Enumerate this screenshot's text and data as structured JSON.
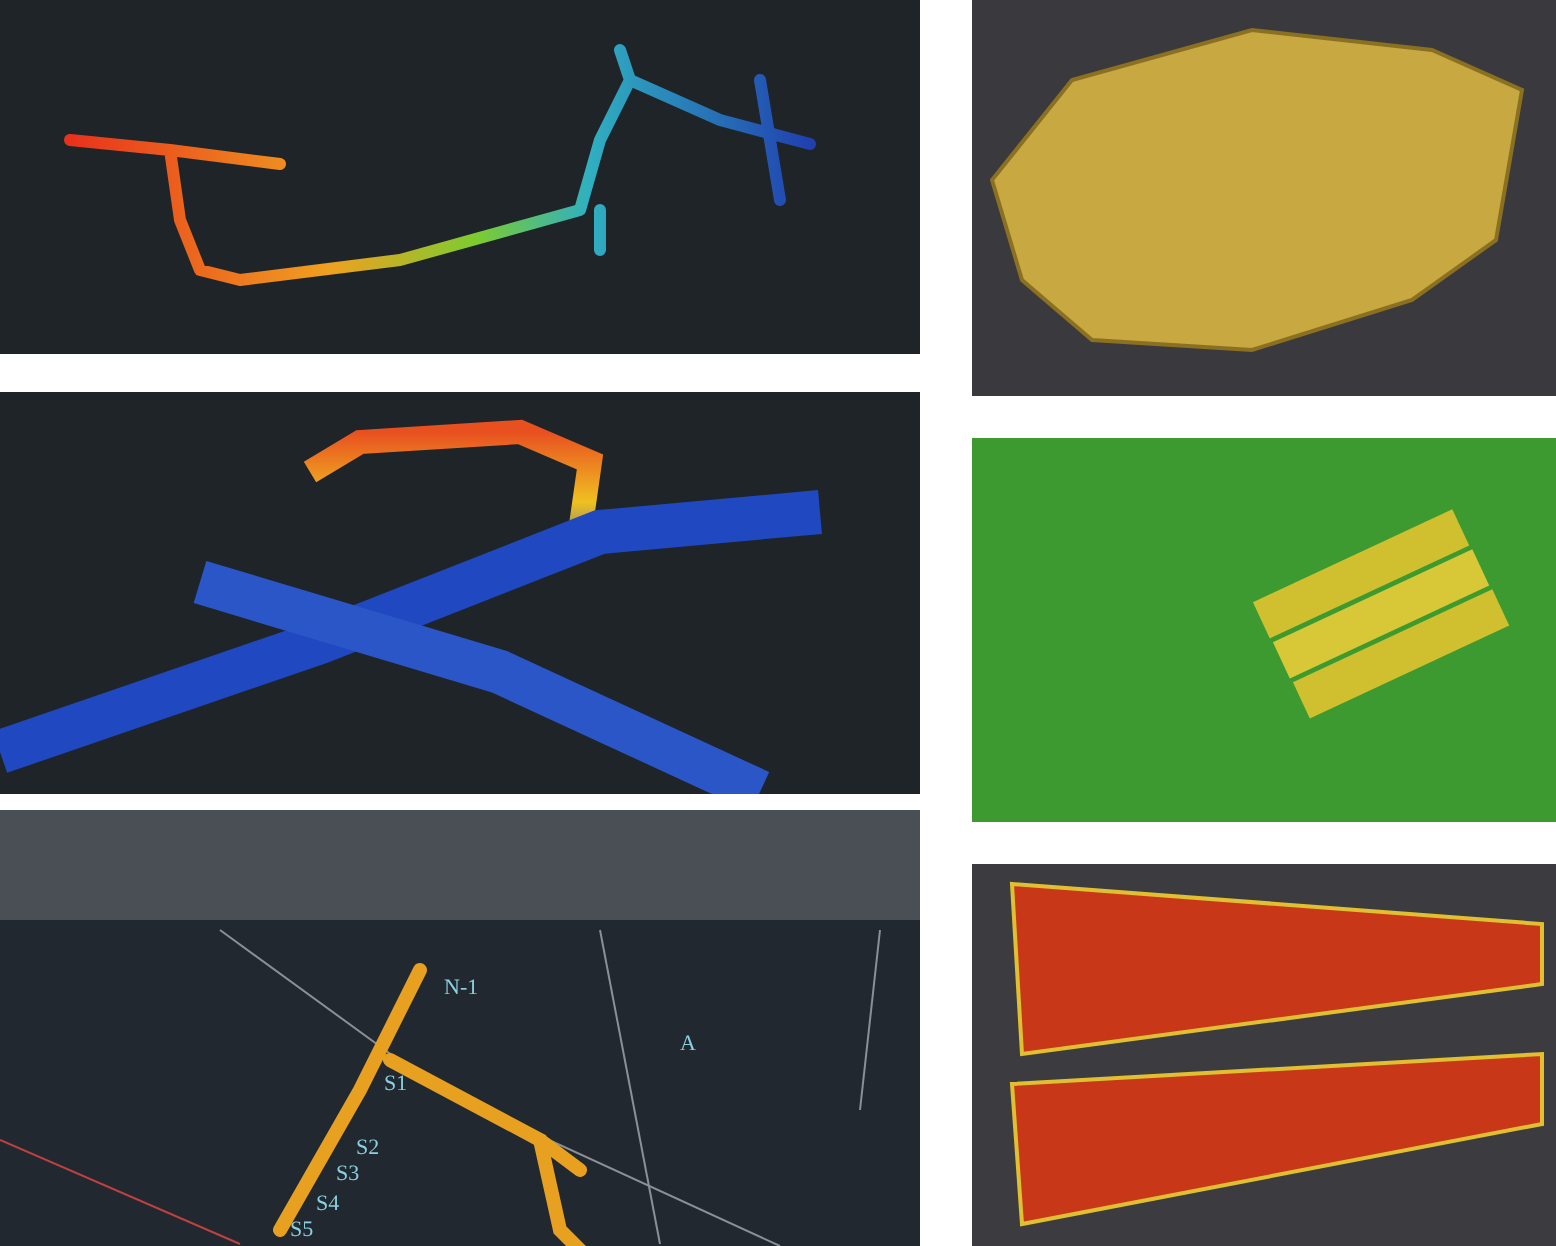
{
  "panels": [
    {
      "kind": "tunnel-gradient"
    },
    {
      "kind": "mesh"
    },
    {
      "kind": "tunnel-layers"
    },
    {
      "kind": "terrain"
    },
    {
      "kind": "cad"
    },
    {
      "kind": "corridor"
    }
  ],
  "cad_labels": [
    "N-1",
    "A",
    "S1",
    "S2",
    "S3",
    "S4",
    "S5"
  ]
}
